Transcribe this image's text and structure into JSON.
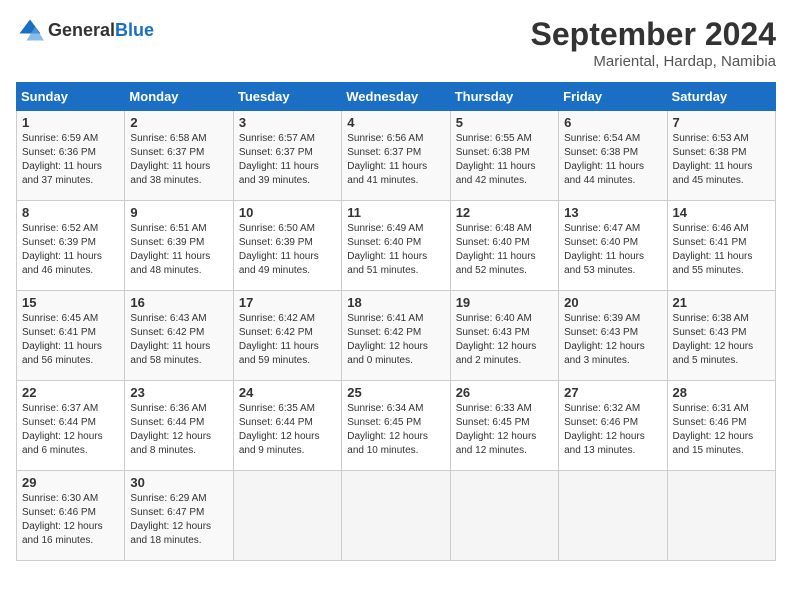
{
  "logo": {
    "general": "General",
    "blue": "Blue"
  },
  "title": "September 2024",
  "location": "Mariental, Hardap, Namibia",
  "days_header": [
    "Sunday",
    "Monday",
    "Tuesday",
    "Wednesday",
    "Thursday",
    "Friday",
    "Saturday"
  ],
  "weeks": [
    [
      {
        "day": "1",
        "text": "Sunrise: 6:59 AM\nSunset: 6:36 PM\nDaylight: 11 hours\nand 37 minutes."
      },
      {
        "day": "2",
        "text": "Sunrise: 6:58 AM\nSunset: 6:37 PM\nDaylight: 11 hours\nand 38 minutes."
      },
      {
        "day": "3",
        "text": "Sunrise: 6:57 AM\nSunset: 6:37 PM\nDaylight: 11 hours\nand 39 minutes."
      },
      {
        "day": "4",
        "text": "Sunrise: 6:56 AM\nSunset: 6:37 PM\nDaylight: 11 hours\nand 41 minutes."
      },
      {
        "day": "5",
        "text": "Sunrise: 6:55 AM\nSunset: 6:38 PM\nDaylight: 11 hours\nand 42 minutes."
      },
      {
        "day": "6",
        "text": "Sunrise: 6:54 AM\nSunset: 6:38 PM\nDaylight: 11 hours\nand 44 minutes."
      },
      {
        "day": "7",
        "text": "Sunrise: 6:53 AM\nSunset: 6:38 PM\nDaylight: 11 hours\nand 45 minutes."
      }
    ],
    [
      {
        "day": "8",
        "text": "Sunrise: 6:52 AM\nSunset: 6:39 PM\nDaylight: 11 hours\nand 46 minutes."
      },
      {
        "day": "9",
        "text": "Sunrise: 6:51 AM\nSunset: 6:39 PM\nDaylight: 11 hours\nand 48 minutes."
      },
      {
        "day": "10",
        "text": "Sunrise: 6:50 AM\nSunset: 6:39 PM\nDaylight: 11 hours\nand 49 minutes."
      },
      {
        "day": "11",
        "text": "Sunrise: 6:49 AM\nSunset: 6:40 PM\nDaylight: 11 hours\nand 51 minutes."
      },
      {
        "day": "12",
        "text": "Sunrise: 6:48 AM\nSunset: 6:40 PM\nDaylight: 11 hours\nand 52 minutes."
      },
      {
        "day": "13",
        "text": "Sunrise: 6:47 AM\nSunset: 6:40 PM\nDaylight: 11 hours\nand 53 minutes."
      },
      {
        "day": "14",
        "text": "Sunrise: 6:46 AM\nSunset: 6:41 PM\nDaylight: 11 hours\nand 55 minutes."
      }
    ],
    [
      {
        "day": "15",
        "text": "Sunrise: 6:45 AM\nSunset: 6:41 PM\nDaylight: 11 hours\nand 56 minutes."
      },
      {
        "day": "16",
        "text": "Sunrise: 6:43 AM\nSunset: 6:42 PM\nDaylight: 11 hours\nand 58 minutes."
      },
      {
        "day": "17",
        "text": "Sunrise: 6:42 AM\nSunset: 6:42 PM\nDaylight: 11 hours\nand 59 minutes."
      },
      {
        "day": "18",
        "text": "Sunrise: 6:41 AM\nSunset: 6:42 PM\nDaylight: 12 hours\nand 0 minutes."
      },
      {
        "day": "19",
        "text": "Sunrise: 6:40 AM\nSunset: 6:43 PM\nDaylight: 12 hours\nand 2 minutes."
      },
      {
        "day": "20",
        "text": "Sunrise: 6:39 AM\nSunset: 6:43 PM\nDaylight: 12 hours\nand 3 minutes."
      },
      {
        "day": "21",
        "text": "Sunrise: 6:38 AM\nSunset: 6:43 PM\nDaylight: 12 hours\nand 5 minutes."
      }
    ],
    [
      {
        "day": "22",
        "text": "Sunrise: 6:37 AM\nSunset: 6:44 PM\nDaylight: 12 hours\nand 6 minutes."
      },
      {
        "day": "23",
        "text": "Sunrise: 6:36 AM\nSunset: 6:44 PM\nDaylight: 12 hours\nand 8 minutes."
      },
      {
        "day": "24",
        "text": "Sunrise: 6:35 AM\nSunset: 6:44 PM\nDaylight: 12 hours\nand 9 minutes."
      },
      {
        "day": "25",
        "text": "Sunrise: 6:34 AM\nSunset: 6:45 PM\nDaylight: 12 hours\nand 10 minutes."
      },
      {
        "day": "26",
        "text": "Sunrise: 6:33 AM\nSunset: 6:45 PM\nDaylight: 12 hours\nand 12 minutes."
      },
      {
        "day": "27",
        "text": "Sunrise: 6:32 AM\nSunset: 6:46 PM\nDaylight: 12 hours\nand 13 minutes."
      },
      {
        "day": "28",
        "text": "Sunrise: 6:31 AM\nSunset: 6:46 PM\nDaylight: 12 hours\nand 15 minutes."
      }
    ],
    [
      {
        "day": "29",
        "text": "Sunrise: 6:30 AM\nSunset: 6:46 PM\nDaylight: 12 hours\nand 16 minutes."
      },
      {
        "day": "30",
        "text": "Sunrise: 6:29 AM\nSunset: 6:47 PM\nDaylight: 12 hours\nand 18 minutes."
      },
      {
        "day": "",
        "text": ""
      },
      {
        "day": "",
        "text": ""
      },
      {
        "day": "",
        "text": ""
      },
      {
        "day": "",
        "text": ""
      },
      {
        "day": "",
        "text": ""
      }
    ]
  ]
}
